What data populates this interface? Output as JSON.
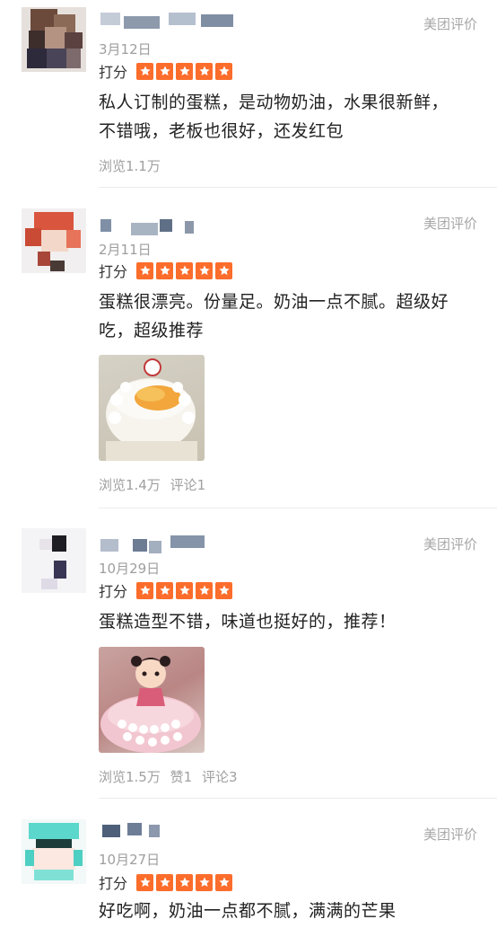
{
  "reviews": [
    {
      "date": "3月12日",
      "source": "美团评价",
      "rating_label": "打分",
      "stars": 5,
      "text_lines": [
        "私人订制的蛋糕，是动物奶油，水果很新鲜，",
        "不错哦，老板也很好，还发红包"
      ],
      "stats": [
        "浏览1.1万"
      ],
      "has_photo": false
    },
    {
      "date": "2月11日",
      "source": "美团评价",
      "rating_label": "打分",
      "stars": 5,
      "text_lines": [
        "蛋糕很漂亮。份量足。奶油一点不腻。超级好",
        "吃，超级推荐"
      ],
      "stats": [
        "浏览1.4万",
        "评论1"
      ],
      "has_photo": true
    },
    {
      "date": "10月29日",
      "source": "美团评价",
      "rating_label": "打分",
      "stars": 5,
      "text_lines": [
        "蛋糕造型不错，味道也挺好的，推荐！"
      ],
      "stats": [
        "浏览1.5万",
        "赞1",
        "评论3"
      ],
      "has_photo": true
    },
    {
      "date": "10月27日",
      "source": "美团评价",
      "rating_label": "打分",
      "stars": 5,
      "text_lines": [
        "好吃啊，奶油一点都不腻，满满的芒果"
      ],
      "stats": [],
      "has_photo": false
    }
  ],
  "colors": {
    "star_bg": "#fc6d2c",
    "muted": "#a0a0a0"
  },
  "icons": {
    "star": "star-icon"
  }
}
